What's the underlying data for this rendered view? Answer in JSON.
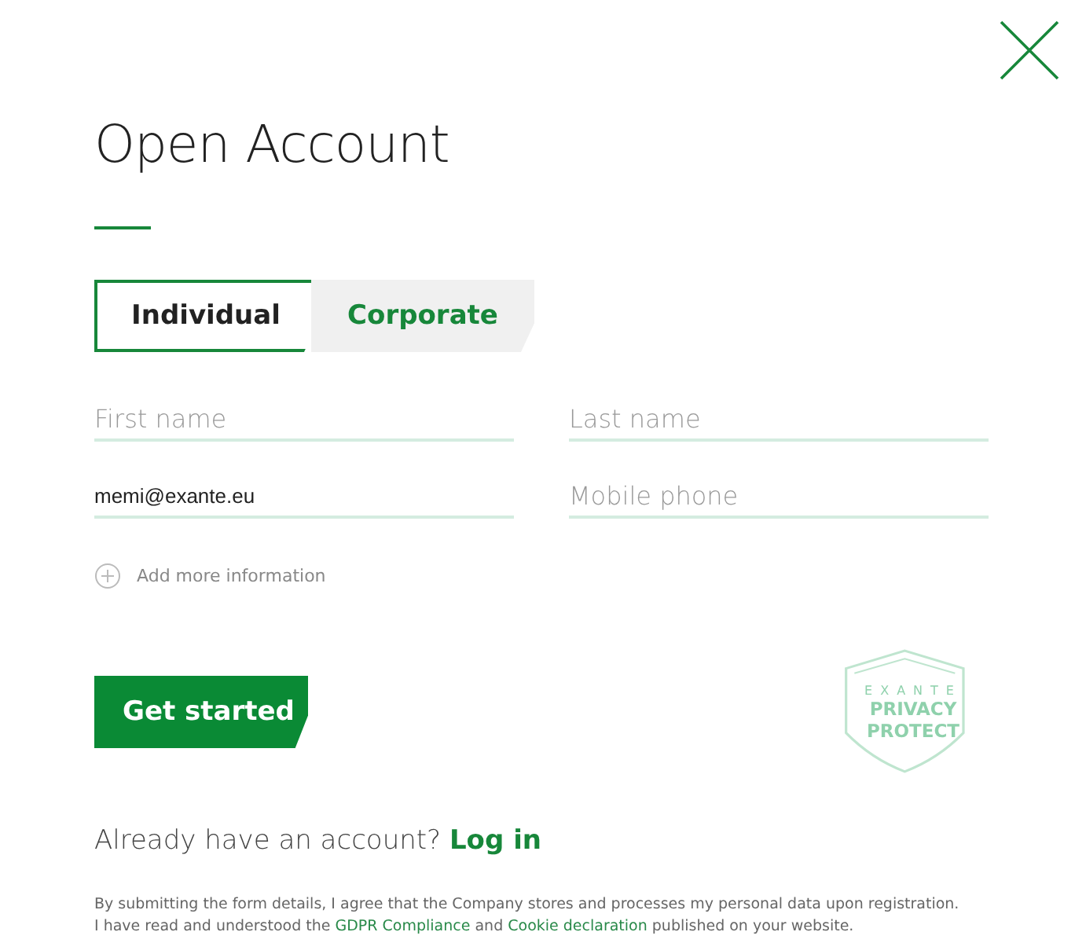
{
  "title": "Open Account",
  "tabs": [
    {
      "label": "Individual",
      "selected": true
    },
    {
      "label": "Corporate",
      "selected": false
    }
  ],
  "fields": [
    {
      "placeholder": "First name"
    },
    {
      "placeholder": "Last name"
    },
    {
      "value": "memi@exante.eu"
    },
    {
      "placeholder": "Mobile phone"
    }
  ],
  "add_more": "Add more information",
  "submit": "Get started",
  "badge": {
    "top": "EXANTE",
    "lines": [
      "PRIVACY",
      "PROTECT"
    ]
  },
  "login": {
    "text": "Already have an account?",
    "link": "Log in"
  },
  "consent": {
    "line1": "By submitting the form details, I agree that the Company stores and processes my personal data upon registration.",
    "line2": [
      {
        "kind": "text",
        "text": "I have read and understood the "
      },
      {
        "kind": "link",
        "text": "GDPR Compliance"
      },
      {
        "kind": "text",
        "text": " and "
      },
      {
        "kind": "link",
        "text": "Cookie declaration"
      },
      {
        "kind": "text",
        "text": " published on your website."
      }
    ]
  }
}
